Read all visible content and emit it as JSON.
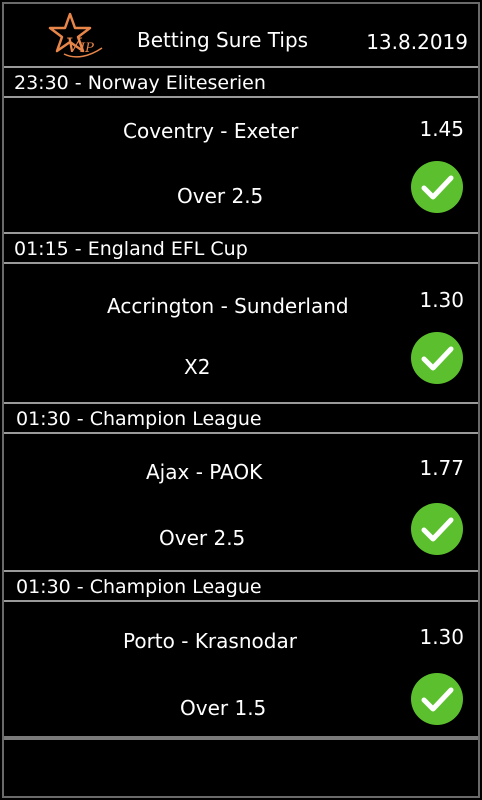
{
  "header": {
    "title": "Betting Sure Tips",
    "date": "13.8.2019",
    "logo_text": "VIP"
  },
  "tips": [
    {
      "league": "23:30 - Norway Eliteserien",
      "match": "Coventry - Exeter",
      "odds": "1.45",
      "pick": "Over 2.5",
      "status": "won"
    },
    {
      "league": "01:15 - England EFL Cup",
      "match": "Accrington - Sunderland",
      "odds": "1.30",
      "pick": "X2",
      "status": "won"
    },
    {
      "league": "01:30 - Champion League",
      "match": "Ajax - PAOK",
      "odds": "1.77",
      "pick": "Over 2.5",
      "status": "won"
    },
    {
      "league": "01:30 - Champion League",
      "match": "Porto - Krasnodar",
      "odds": "1.30",
      "pick": "Over 1.5",
      "status": "won"
    }
  ],
  "colors": {
    "accent": "#e8864a",
    "success": "#5cc02e",
    "divider": "#9a9a9a"
  },
  "icons": {
    "status": "check-circle-icon",
    "logo": "vip-star-icon"
  }
}
